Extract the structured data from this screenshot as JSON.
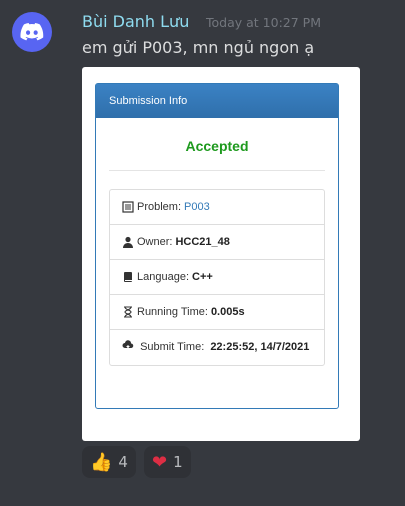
{
  "author": {
    "name": "Bùi Danh Lưu",
    "timestamp": "Today at 10:27 PM"
  },
  "message": {
    "text": "em gửi P003, mn ngủ ngon ạ"
  },
  "submission": {
    "heading": "Submission Info",
    "status": "Accepted",
    "problem_label": "Problem:",
    "problem_value": "P003",
    "owner_label": "Owner:",
    "owner_value": "HCC21_48",
    "language_label": "Language:",
    "language_value": "C++",
    "running_time_label": "Running Time:",
    "running_time_value": "0.005s",
    "submit_time_label": "Submit Time:",
    "submit_time_value": "22:25:52, 14/7/2021"
  },
  "reactions": [
    {
      "icon": "thumbs-up",
      "emoji": "👍",
      "count": "4"
    },
    {
      "icon": "red-heart",
      "emoji": "❤",
      "count": "1"
    }
  ],
  "colors": {
    "background": "#36393f",
    "username": "#8fdcf0",
    "accepted": "#1e9a1e",
    "panel_header": "#337ab7",
    "avatar": "#5865f2"
  }
}
